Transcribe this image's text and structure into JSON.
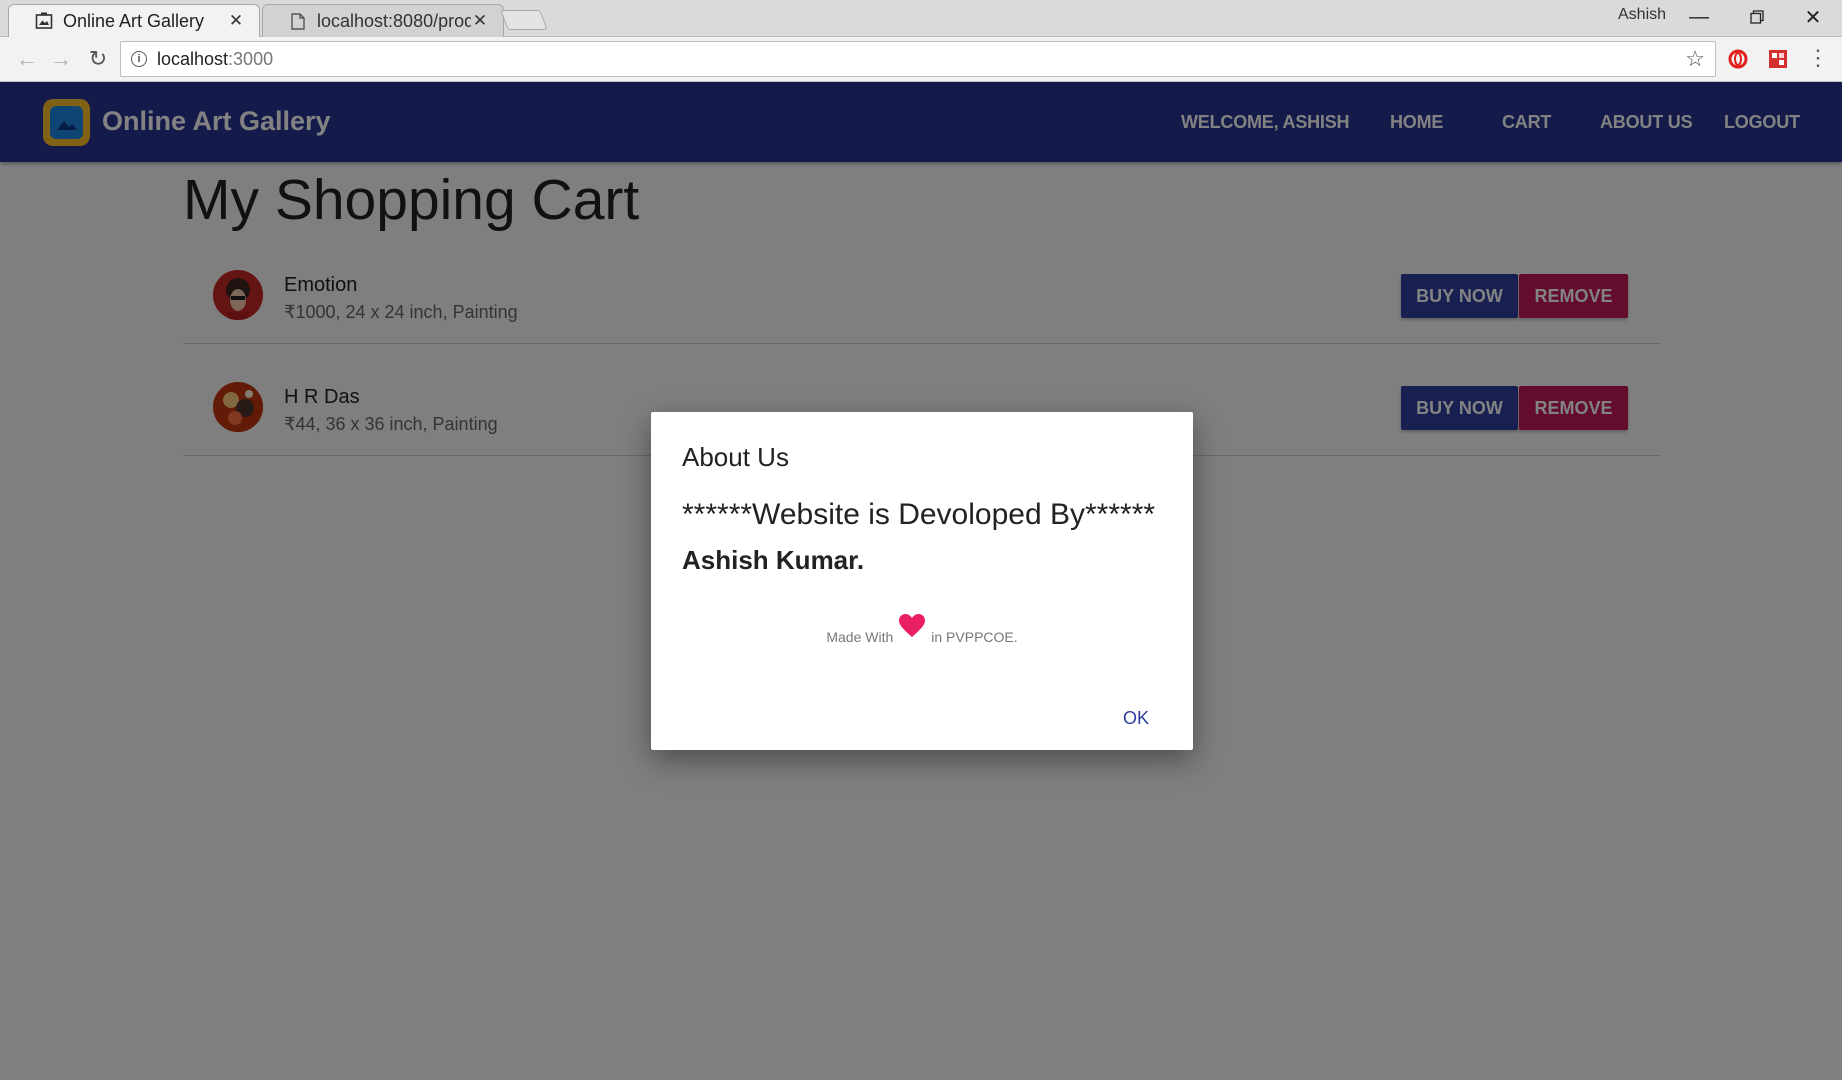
{
  "browser": {
    "tabs": [
      {
        "title": "Online Art Gallery",
        "active": true
      },
      {
        "title": "localhost:8080/produ",
        "active": false
      }
    ],
    "user": "Ashish",
    "url_host": "localhost",
    "url_port": ":3000"
  },
  "app": {
    "title": "Online Art Gallery",
    "nav": {
      "welcome": "WELCOME,  ASHISH",
      "home": "HOME",
      "cart": "CART",
      "about": "ABOUT US",
      "logout": "LOGOUT"
    },
    "colors": {
      "appbar": "#283593",
      "buy": "#303f9f",
      "remove": "#c2185b",
      "heart": "#e91e63"
    }
  },
  "cart": {
    "title": "My Shopping Cart",
    "items": [
      {
        "name": "Emotion",
        "meta": "₹1000, 24 x 24 inch, Painting",
        "buy_label": "BUY NOW",
        "remove_label": "REMOVE"
      },
      {
        "name": "H R Das",
        "meta": "₹44, 36 x 36 inch, Painting",
        "buy_label": "BUY NOW",
        "remove_label": "REMOVE"
      }
    ]
  },
  "dialog": {
    "title": "About Us",
    "line1": "******Website is Devoloped By******",
    "line2": "Ashish Kumar.",
    "made_with": "Made With",
    "made_in": "in PVPPCOE.",
    "ok_label": "OK"
  }
}
